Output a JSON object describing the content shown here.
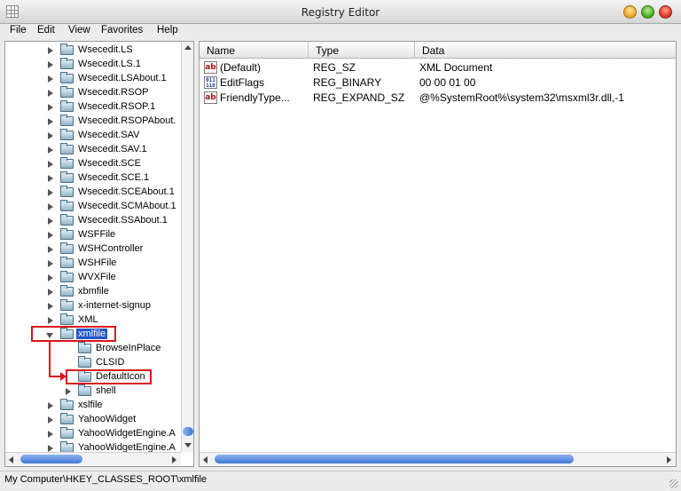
{
  "window": {
    "title": "Registry Editor"
  },
  "menu": [
    "File",
    "Edit",
    "View",
    "Favorites",
    "Help"
  ],
  "tree": {
    "items": [
      {
        "label": "Wsecedit.LS",
        "expander": "collapsed",
        "indent": 0
      },
      {
        "label": "Wsecedit.LS.1",
        "expander": "collapsed",
        "indent": 0
      },
      {
        "label": "Wsecedit.LSAbout.1",
        "expander": "collapsed",
        "indent": 0
      },
      {
        "label": "Wsecedit.RSOP",
        "expander": "collapsed",
        "indent": 0
      },
      {
        "label": "Wsecedit.RSOP.1",
        "expander": "collapsed",
        "indent": 0
      },
      {
        "label": "Wsecedit.RSOPAbout.",
        "expander": "collapsed",
        "indent": 0
      },
      {
        "label": "Wsecedit.SAV",
        "expander": "collapsed",
        "indent": 0
      },
      {
        "label": "Wsecedit.SAV.1",
        "expander": "collapsed",
        "indent": 0
      },
      {
        "label": "Wsecedit.SCE",
        "expander": "collapsed",
        "indent": 0
      },
      {
        "label": "Wsecedit.SCE.1",
        "expander": "collapsed",
        "indent": 0
      },
      {
        "label": "Wsecedit.SCEAbout.1",
        "expander": "collapsed",
        "indent": 0
      },
      {
        "label": "Wsecedit.SCMAbout.1",
        "expander": "collapsed",
        "indent": 0
      },
      {
        "label": "Wsecedit.SSAbout.1",
        "expander": "collapsed",
        "indent": 0
      },
      {
        "label": "WSFFile",
        "expander": "collapsed",
        "indent": 0
      },
      {
        "label": "WSHController",
        "expander": "collapsed",
        "indent": 0
      },
      {
        "label": "WSHFile",
        "expander": "collapsed",
        "indent": 0
      },
      {
        "label": "WVXFile",
        "expander": "collapsed",
        "indent": 0
      },
      {
        "label": "xbmfile",
        "expander": "collapsed",
        "indent": 0
      },
      {
        "label": "x-internet-signup",
        "expander": "collapsed",
        "indent": 0
      },
      {
        "label": "XML",
        "expander": "collapsed",
        "indent": 0
      },
      {
        "label": "xmlfile",
        "expander": "expanded",
        "indent": 0,
        "selected": true
      },
      {
        "label": "BrowseInPlace",
        "expander": "none",
        "indent": 1
      },
      {
        "label": "CLSID",
        "expander": "none",
        "indent": 1
      },
      {
        "label": "DefaultIcon",
        "expander": "none",
        "indent": 1
      },
      {
        "label": "shell",
        "expander": "collapsed",
        "indent": 1
      },
      {
        "label": "xslfile",
        "expander": "collapsed",
        "indent": 0
      },
      {
        "label": "YahooWidget",
        "expander": "collapsed",
        "indent": 0
      },
      {
        "label": "YahooWidgetEngine.A",
        "expander": "collapsed",
        "indent": 0
      },
      {
        "label": "YahooWidgetEngine.A",
        "expander": "collapsed",
        "indent": 0
      }
    ]
  },
  "list": {
    "columns": [
      "Name",
      "Type",
      "Data"
    ],
    "rows": [
      {
        "icon": "string-value-icon",
        "icon_text": "ab",
        "name": "(Default)",
        "type": "REG_SZ",
        "data": "XML Document"
      },
      {
        "icon": "binary-value-icon",
        "icon_text": "011 110",
        "name": "EditFlags",
        "type": "REG_BINARY",
        "data": "00 00 01 00"
      },
      {
        "icon": "string-value-icon",
        "icon_text": "ab",
        "name": "FriendlyType...",
        "type": "REG_EXPAND_SZ",
        "data": "@%SystemRoot%\\system32\\msxml3r.dll,-1"
      }
    ]
  },
  "status": {
    "path": "My Computer\\HKEY_CLASSES_ROOT\\xmlfile"
  },
  "colors": {
    "selection": "#2357c9",
    "annotation": "#d8141c",
    "scroll_thumb": "#3e76d4"
  }
}
